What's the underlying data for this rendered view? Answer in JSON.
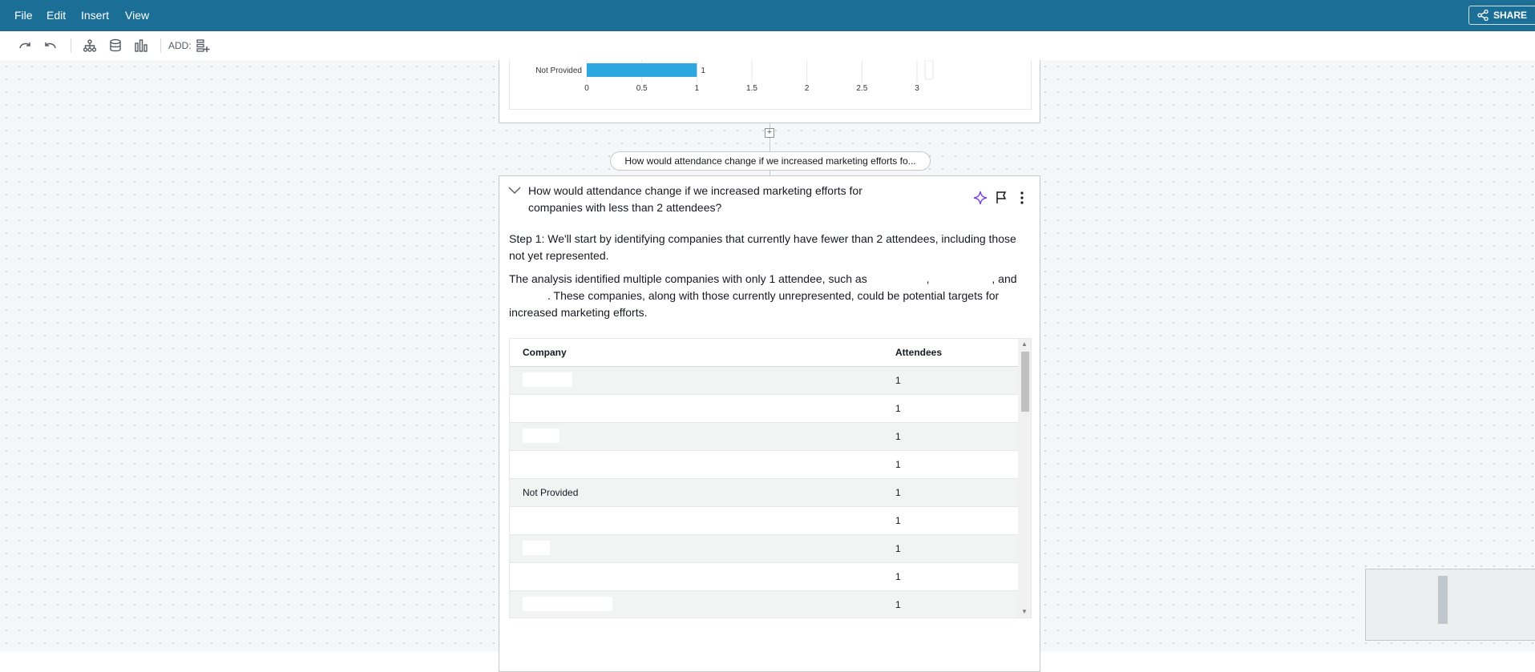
{
  "menu": {
    "file": "File",
    "edit": "Edit",
    "insert": "Insert",
    "view": "View",
    "share": "SHARE"
  },
  "toolbar": {
    "add_label": "ADD:"
  },
  "chart_data": {
    "type": "bar",
    "categories": [
      "Not Provided"
    ],
    "values": [
      1
    ],
    "data_labels": [
      "1"
    ],
    "xlim": [
      0,
      3
    ],
    "x_ticks": [
      "0",
      "0.5",
      "1",
      "1.5",
      "2",
      "2.5",
      "3"
    ],
    "bar_color": "#2ea7e0",
    "grid": true
  },
  "pill": {
    "question": "How would attendance change if we increased marketing efforts fo..."
  },
  "card": {
    "question": "How would attendance change if we increased marketing efforts for companies with less than 2 attendees?",
    "step1": "Step 1: We'll start by identifying companies that currently have fewer than 2 attendees, including those not yet represented.",
    "analysis_part1": "The analysis identified multiple companies with only 1 attendee, such as",
    "analysis_part2": "These companies, along with those currently unrepresented, could be potential targets for increased marketing efforts."
  },
  "table": {
    "headers": [
      "Company",
      "Attendees"
    ],
    "rows": [
      {
        "company": "",
        "attendees": "1"
      },
      {
        "company": "",
        "attendees": "1"
      },
      {
        "company": "",
        "attendees": "1"
      },
      {
        "company": "",
        "attendees": "1"
      },
      {
        "company": "Not Provided",
        "attendees": "1"
      },
      {
        "company": "",
        "attendees": "1"
      },
      {
        "company": "",
        "attendees": "1"
      },
      {
        "company": "",
        "attendees": "1"
      },
      {
        "company": "",
        "attendees": "1"
      }
    ]
  },
  "colors": {
    "menubar": "#1b6f97",
    "accent_purple": "#7b3fe4"
  }
}
